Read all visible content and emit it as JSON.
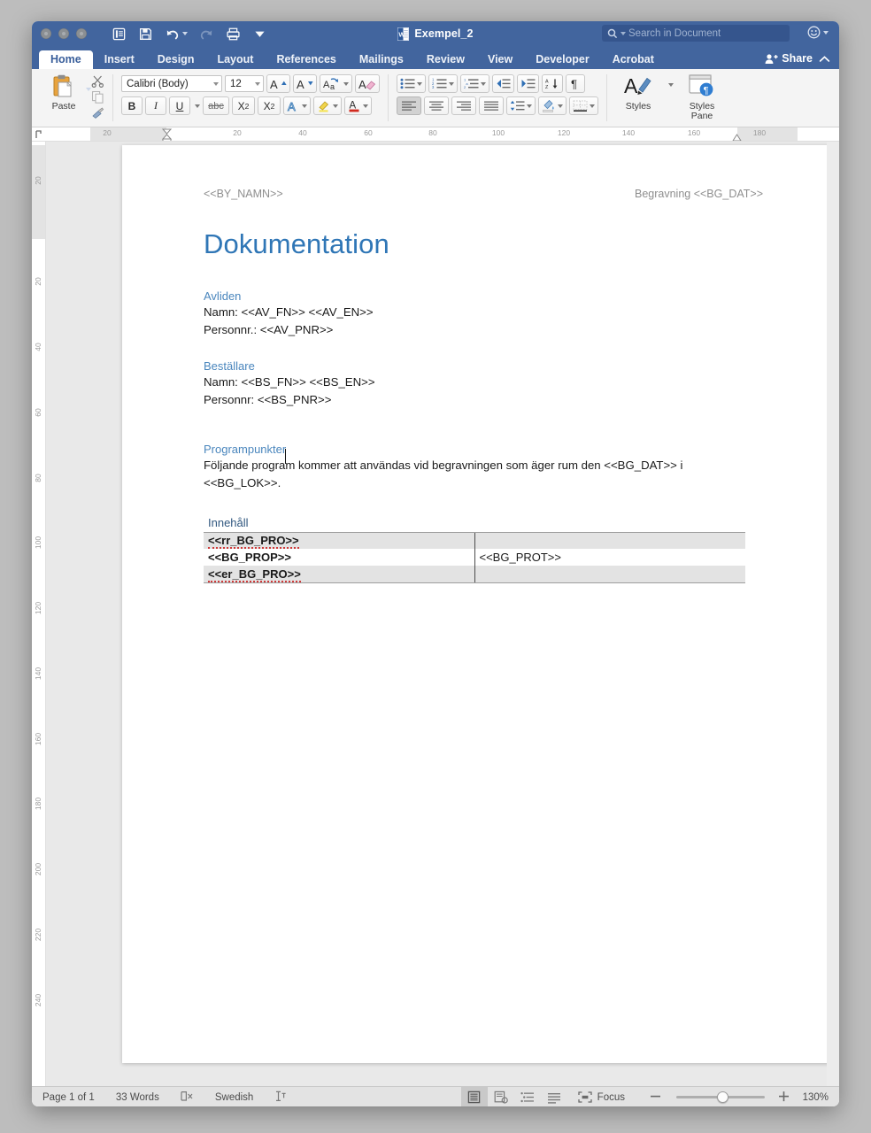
{
  "window": {
    "title": "Exempel_2",
    "doc_icon": "word-document-icon",
    "traffic_lights": [
      "close-button",
      "minimize-button",
      "maximize-button"
    ]
  },
  "quick_access": [
    {
      "name": "print-layout-view-icon",
      "label": "Print Layout"
    },
    {
      "name": "save-icon",
      "label": "Save"
    },
    {
      "name": "undo-icon",
      "label": "Undo"
    },
    {
      "name": "redo-icon",
      "label": "Redo"
    },
    {
      "name": "print-icon",
      "label": "Print"
    },
    {
      "name": "customize-toolbar-icon",
      "label": "Customize"
    }
  ],
  "search": {
    "placeholder": "Search in Document",
    "icon": "search-icon"
  },
  "account": {
    "icon": "smiley-face-icon"
  },
  "tabs": [
    {
      "label": "Home",
      "active": true
    },
    {
      "label": "Insert",
      "active": false
    },
    {
      "label": "Design",
      "active": false
    },
    {
      "label": "Layout",
      "active": false
    },
    {
      "label": "References",
      "active": false
    },
    {
      "label": "Mailings",
      "active": false
    },
    {
      "label": "Review",
      "active": false
    },
    {
      "label": "View",
      "active": false
    },
    {
      "label": "Developer",
      "active": false
    },
    {
      "label": "Acrobat",
      "active": false
    }
  ],
  "share": {
    "label": "Share",
    "icon": "share-person-icon"
  },
  "ribbon_collapse": {
    "icon": "chevron-up-icon"
  },
  "ribbon": {
    "clipboard": {
      "paste_label": "Paste",
      "paste_icon": "paste-clipboard-icon",
      "cut_icon": "scissors-icon",
      "copy_icon": "copy-icon",
      "format_painter_icon": "format-painter-icon"
    },
    "font": {
      "family_value": "Calibri (Body)",
      "size_value": "12",
      "grow_font_icon": "grow-font-icon",
      "shrink_font_icon": "shrink-font-icon",
      "change_case_icon": "change-case-icon",
      "clear_formatting_icon": "clear-formatting-icon",
      "bold_label": "B",
      "italic_label": "I",
      "underline_label": "U",
      "strikethrough_label": "abc",
      "subscript_label": "X",
      "subscript_sub": "2",
      "superscript_label": "X",
      "superscript_sup": "2",
      "text_effects_icon": "text-effects-icon",
      "highlight_icon": "highlight-color-icon",
      "font_color_icon": "font-color-icon"
    },
    "paragraph": {
      "bullets_icon": "bullet-list-icon",
      "numbering_icon": "numbered-list-icon",
      "multilevel_icon": "multilevel-list-icon",
      "decrease_indent_icon": "decrease-indent-icon",
      "increase_indent_icon": "increase-indent-icon",
      "sort_icon": "sort-az-icon",
      "show_marks_icon": "pilcrow-icon",
      "align_left_icon": "align-left-icon",
      "align_center_icon": "align-center-icon",
      "align_right_icon": "align-right-icon",
      "justify_icon": "justify-icon",
      "line_spacing_icon": "line-spacing-icon",
      "shading_icon": "shading-icon",
      "borders_icon": "borders-icon"
    },
    "styles": {
      "styles_label": "Styles",
      "styles_icon": "styles-icon",
      "styles_pane_label_1": "Styles",
      "styles_pane_label_2": "Pane",
      "styles_pane_icon": "styles-pane-icon"
    }
  },
  "ruler": {
    "h_numbers": [
      "20",
      "20",
      "40",
      "60",
      "80",
      "100",
      "120",
      "140",
      "160",
      "180"
    ],
    "v_numbers": [
      "20",
      "20",
      "40",
      "60",
      "80",
      "100",
      "120",
      "140",
      "160",
      "180",
      "200",
      "220",
      "240"
    ],
    "tab_stop_icon": "left-tab-stop-icon"
  },
  "document": {
    "header_left": "<<BY_NAMN>>",
    "header_right": "Begravning <<BG_DAT>>",
    "title": "Dokumentation",
    "sections": [
      {
        "heading": "Avliden",
        "lines": [
          "Namn: <<AV_FN>> <<AV_EN>>",
          "Personnr.: <<AV_PNR>>"
        ]
      },
      {
        "heading": "Beställare",
        "lines": [
          "Namn: <<BS_FN>> <<BS_EN>>",
          "Personnr: <<BS_PNR>>"
        ]
      },
      {
        "heading": "Programpunkter",
        "lines": [
          "Följande program kommer att användas vid begravningen som äger rum den <<BG_DAT>> i <<BG_LOK>>."
        ]
      }
    ],
    "table": {
      "header": "Innehåll",
      "rows": [
        {
          "col1": "<<rr_BG_PRO>>",
          "col2": "",
          "shaded": true,
          "misspelled": true
        },
        {
          "col1": "<<BG_PROP>>",
          "col2": "<<BG_PROT>>",
          "shaded": false,
          "misspelled": false
        },
        {
          "col1": "<<er_BG_PRO>>",
          "col2": "",
          "shaded": true,
          "misspelled": true
        }
      ]
    }
  },
  "status_bar": {
    "page": "Page 1 of 1",
    "words": "33 Words",
    "proofing_icon": "proofing-errors-icon",
    "language": "Swedish",
    "track_changes_icon": "track-changes-icon",
    "views": [
      {
        "name": "print-layout-view-icon",
        "active": true
      },
      {
        "name": "web-layout-view-icon",
        "active": false
      },
      {
        "name": "outline-view-icon",
        "active": false
      },
      {
        "name": "draft-view-icon",
        "active": false
      }
    ],
    "focus_label": "Focus",
    "focus_icon": "focus-mode-icon",
    "zoom_out_icon": "zoom-out-icon",
    "zoom_in_icon": "zoom-in-icon",
    "zoom_value": "130%"
  },
  "colors": {
    "titlebar": "#42659e",
    "heading_blue": "#2f76b6",
    "subheading_blue": "#4a86bd",
    "table_shade": "#e3e3e3",
    "spell_error": "#cf3a3a"
  }
}
